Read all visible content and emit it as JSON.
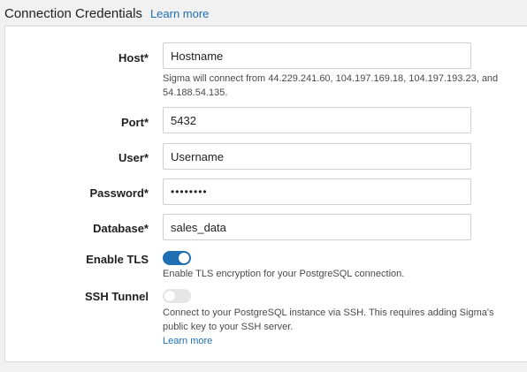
{
  "header": {
    "title": "Connection Credentials",
    "learn_more": "Learn more"
  },
  "fields": {
    "host": {
      "label": "Host*",
      "value": "Hostname",
      "helper": "Sigma will connect from 44.229.241.60, 104.197.169.18, 104.197.193.23, and 54.188.54.135."
    },
    "port": {
      "label": "Port*",
      "value": "5432"
    },
    "user": {
      "label": "User*",
      "value": "Username"
    },
    "password": {
      "label": "Password*",
      "value": "••••••••"
    },
    "database": {
      "label": "Database*",
      "value": "sales_data"
    },
    "enable_tls": {
      "label": "Enable TLS",
      "enabled": true,
      "helper": "Enable TLS encryption for your PostgreSQL connection."
    },
    "ssh_tunnel": {
      "label": "SSH Tunnel",
      "enabled": false,
      "helper": "Connect to your PostgreSQL instance via SSH. This requires adding Sigma's public key to your SSH server.",
      "learn_more": "Learn more"
    }
  },
  "colors": {
    "accent": "#1f6fb2",
    "link": "#1d6fb5",
    "toggle_off": "#e6e6e6"
  }
}
